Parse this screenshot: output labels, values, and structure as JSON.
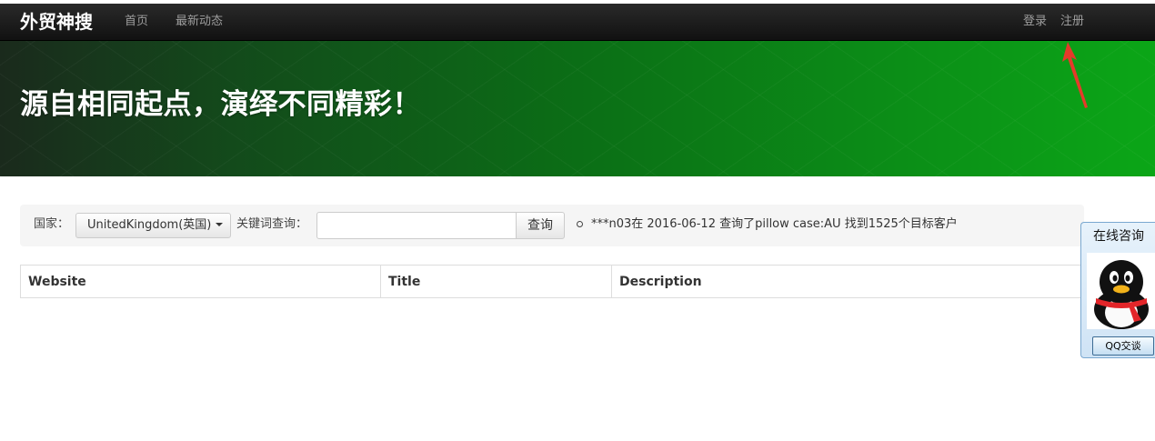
{
  "navbar": {
    "brand": "外贸神搜",
    "links": [
      "首页",
      "最新动态"
    ],
    "right_links": [
      "登录",
      "注册"
    ]
  },
  "hero": {
    "title": "源自相同起点，演绎不同精彩！"
  },
  "search": {
    "country_label": "国家：",
    "country_value": "UnitedKingdom(英国)",
    "keyword_label": "关键词查询：",
    "keyword_value": "",
    "query_button": "查询",
    "recent_activity": "***n03在 2016-06-12 查询了pillow case:AU 找到1525个目标客户"
  },
  "table": {
    "headers": [
      "Website",
      "Title",
      "Description"
    ]
  },
  "qq_widget": {
    "title": "在线咨询",
    "button": "QQ交谈"
  },
  "colors": {
    "navbar": "#1b1b1b",
    "hero_green": "#0b8e17",
    "annotation_arrow": "#e53a2a"
  }
}
